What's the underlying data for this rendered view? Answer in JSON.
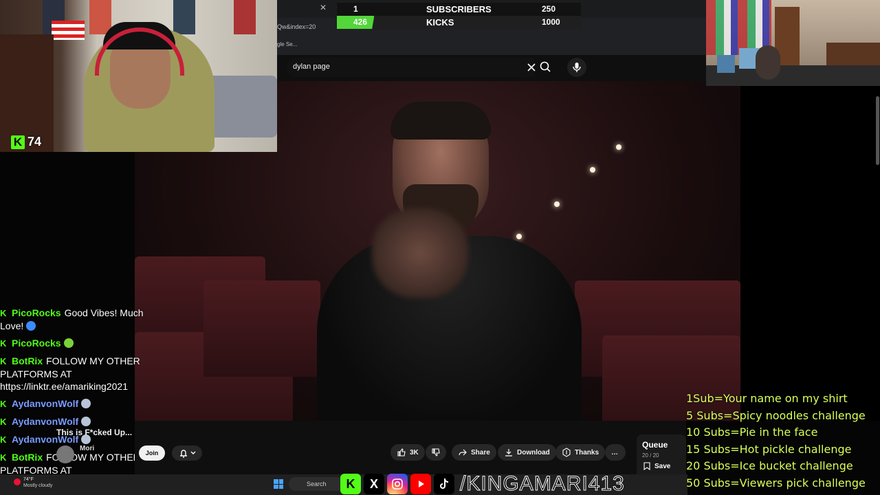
{
  "browser": {
    "url_fragment": "Qw&index=20",
    "bookmark_fragment": "gle Se..."
  },
  "goal": {
    "current_top": "1",
    "label_top": "SUBSCRIBERS",
    "target_top": "250",
    "current_bottom": "426",
    "label_bottom": "KICKS",
    "target_bottom": "1000",
    "progress_bottom": 0.426,
    "accent": "#53d63a"
  },
  "search": {
    "query": "dylan page"
  },
  "webcam": {
    "viewer_count": "74",
    "kick_icon": "K"
  },
  "chat": {
    "messages": [
      {
        "user": "PicoRocks",
        "text": "Good Vibes! Much Love!",
        "emote": "blue-heart-icon",
        "color": "#53fc18"
      },
      {
        "user": "PicoRocks",
        "text": "",
        "emote": "green-emoji-icon",
        "color": "#53fc18"
      },
      {
        "user": "BotRix",
        "text": "FOLLOW MY OTHER PLATFORMS AT https://linktr.ee/amariking2021",
        "emote": "",
        "color": "#53fc18"
      },
      {
        "user": "AydanvonWolf",
        "text": "",
        "emote": "wolf-emote-icon",
        "color": "#7a9cff"
      },
      {
        "user": "AydanvonWolf",
        "text": "",
        "emote": "wolf-emote-icon",
        "color": "#7a9cff"
      },
      {
        "user": "AydanvonWolf",
        "text": "",
        "emote": "wolf-emote-icon",
        "color": "#7a9cff"
      },
      {
        "user": "BotRix",
        "text": "FOLLOW MY OTHER PLATFORMS AT https://linktr.ee/amariking2021",
        "emote": "",
        "color": "#53fc18"
      }
    ]
  },
  "video": {
    "title": "This is F*cked Up...",
    "channel": "Mori",
    "join_label": "Join",
    "likes": "3K",
    "share_label": "Share",
    "download_label": "Download",
    "thanks_label": "Thanks",
    "more_label": "…"
  },
  "queue": {
    "title": "Queue",
    "count": "20 / 20",
    "save_label": "Save"
  },
  "taskbar": {
    "weather_temp": "74°F",
    "weather_text": "Mostly cloudy",
    "search_label": "Search"
  },
  "socials": {
    "handle": "/KINGAMARI413",
    "icons": [
      "kick-icon",
      "x-icon",
      "instagram-icon",
      "youtube-icon",
      "tiktok-icon"
    ]
  },
  "subgoals": [
    "1Sub=Your name on my shirt",
    "5 Subs=Spicy noodles challenge",
    "10 Subs=Pie in the face",
    "15 Subs=Hot pickle challenge",
    "20 Subs=Ice bucket challenge",
    "50 Subs=Viewers pick challenge"
  ]
}
